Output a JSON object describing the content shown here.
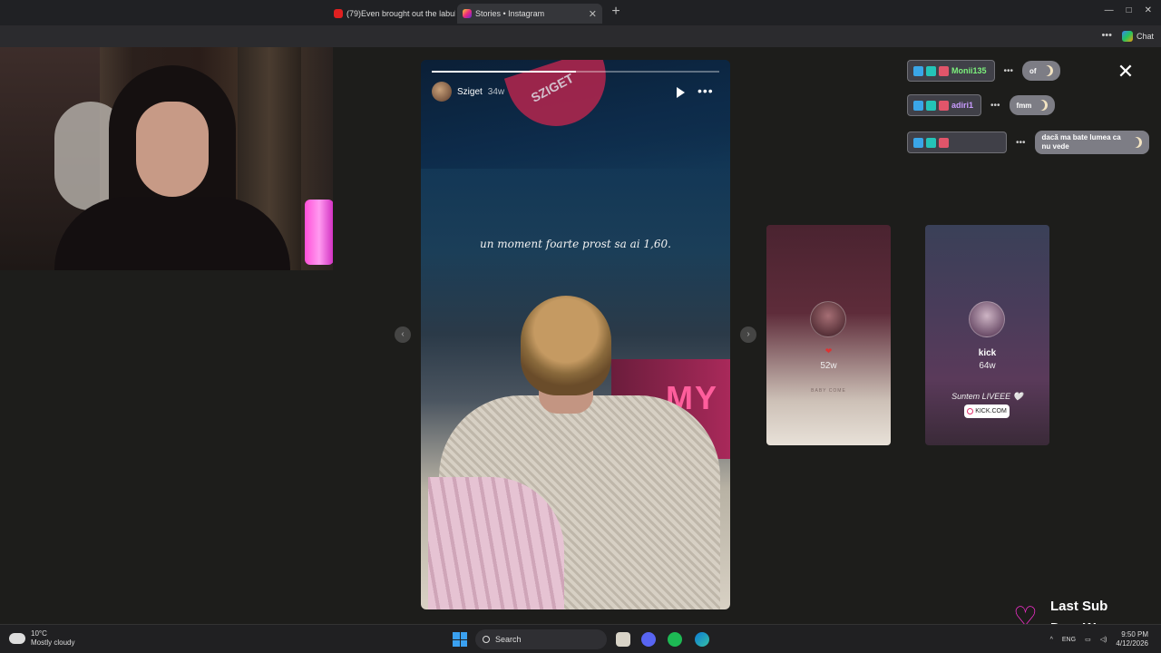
{
  "browser": {
    "tabs": [
      {
        "label": "(79)Even brought out the labubu 🥲",
        "active": false
      },
      {
        "label": "Stories • Instagram",
        "active": true
      }
    ],
    "new_tab": "+",
    "chat_label": "Chat"
  },
  "story": {
    "username": "Sziget",
    "time": "34w",
    "overlay_text": "un moment foarte prost sa ai 1,60.",
    "banner_text": "SZIGET",
    "sign_text": "MY N",
    "progress": 0.5
  },
  "next_stories": [
    {
      "heart": "❤",
      "time": "52w",
      "sub": "BABY COME"
    },
    {
      "name": "kick",
      "time": "64w",
      "caption": "Suntem LIVEEE 🤍",
      "link": "KICK.COM"
    }
  ],
  "chat": [
    {
      "user": "Monii135",
      "msg": "of",
      "color": "#7cf07c"
    },
    {
      "user": "adiri1",
      "msg": "fmm",
      "color": "#c99cff"
    },
    {
      "user": "",
      "msg": "dacă ma bate lumea ca nu vede",
      "color": "#ff4d6a"
    }
  ],
  "last_sub": {
    "title": "Last Sub",
    "name": "DeeaW"
  },
  "taskbar": {
    "weather_temp": "10°C",
    "weather_desc": "Mostly cloudy",
    "search_label": "Search",
    "lang": "ENG",
    "time": "9:50 PM",
    "date": "4/12/2026"
  },
  "colors": {
    "accent_pink": "#ff2fd6",
    "instagram": "#e1306c"
  }
}
